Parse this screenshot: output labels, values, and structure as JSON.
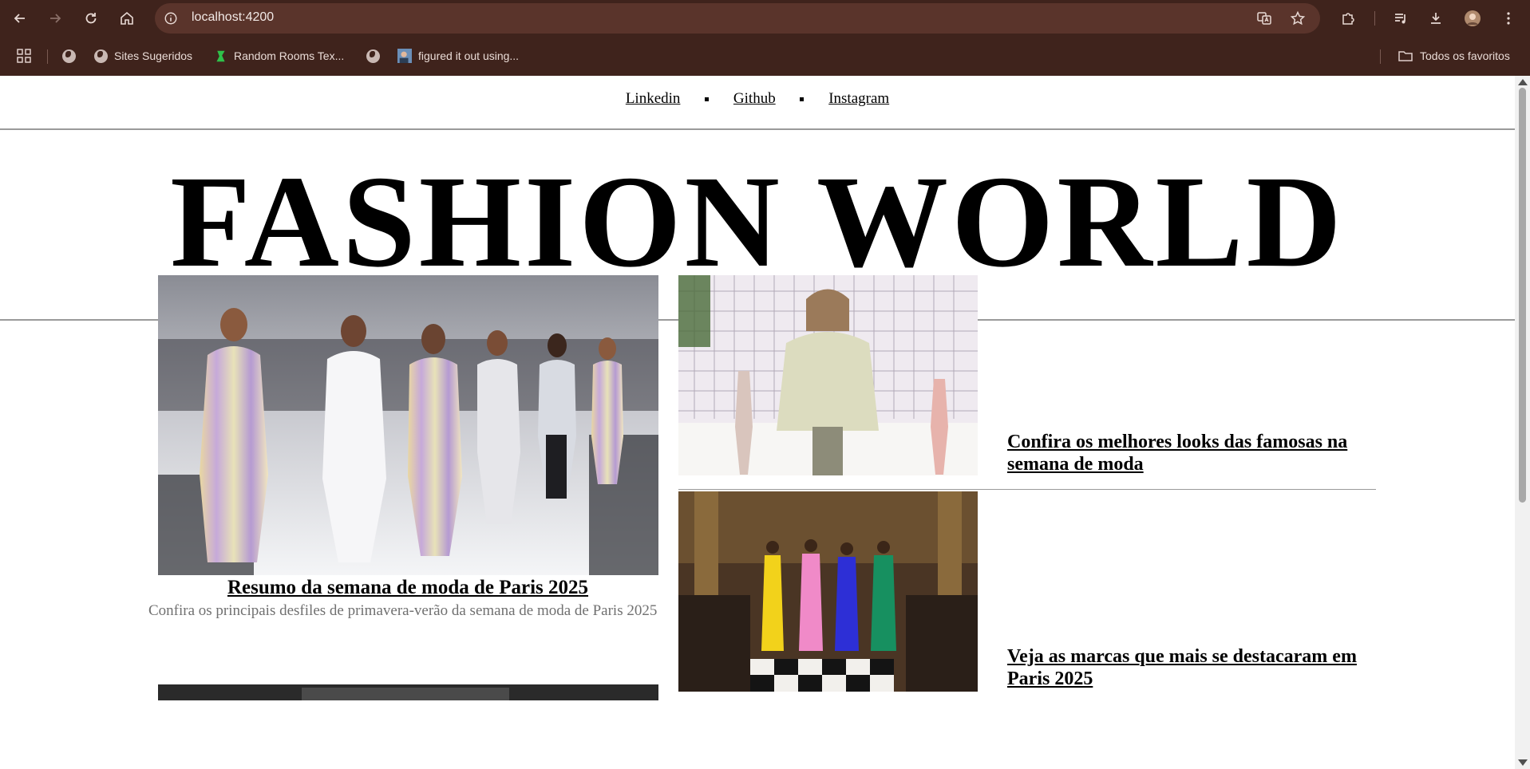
{
  "browser": {
    "url": "localhost:4200",
    "bookmarks": [
      {
        "label": "",
        "icon": "globe-icon"
      },
      {
        "label": "Sites Sugeridos",
        "icon": "globe-icon"
      },
      {
        "label": "Random Rooms Tex...",
        "icon": "green-bookmark-icon"
      },
      {
        "label": "",
        "icon": "globe-icon"
      },
      {
        "label": "figured it out using...",
        "icon": "thumbnail-icon"
      }
    ],
    "all_bookmarks_label": "Todos os favoritos"
  },
  "nav": {
    "links": [
      "Linkedin",
      "Github",
      "Instagram"
    ]
  },
  "masthead": "FASHION WORLD",
  "featured": {
    "title": "Resumo da semana de moda de Paris 2025",
    "description": "Confira os principais desfiles de primavera-verão da semana de moda de Paris 2025"
  },
  "side_articles": [
    {
      "title": "Confira os melhores looks das famosas na semana de moda"
    },
    {
      "title": "Veja as marcas que mais se destacaram em Paris 2025"
    }
  ],
  "colors": {
    "chrome": "#3f231c",
    "omnibox": "#5a342b",
    "rule": "#9a9a9a",
    "description": "#707070"
  }
}
